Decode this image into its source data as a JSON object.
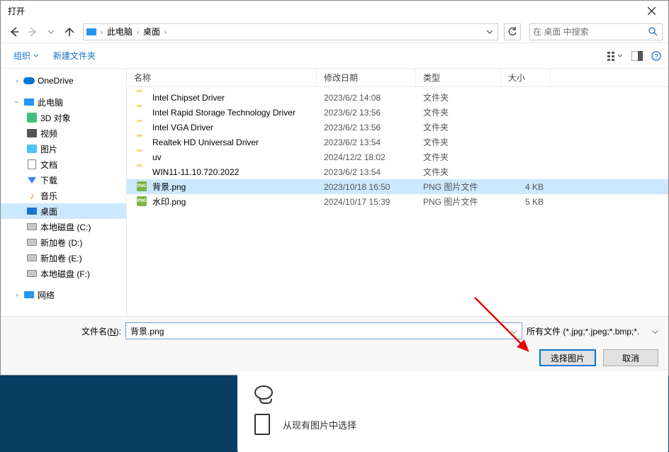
{
  "dialog": {
    "title": "打开",
    "breadcrumb": [
      "此电脑",
      "桌面"
    ],
    "search_placeholder": "在 桌面 中搜索"
  },
  "toolbar": {
    "organize": "组织",
    "new_folder": "新建文件夹"
  },
  "columns": {
    "name": "名称",
    "date": "修改日期",
    "type": "类型",
    "size": "大小"
  },
  "sidebar": {
    "onedrive": "OneDrive",
    "this_pc": "此电脑",
    "items_pc": [
      {
        "label": "3D 对象",
        "icon": "green3d"
      },
      {
        "label": "视频",
        "icon": "video"
      },
      {
        "label": "图片",
        "icon": "pic"
      },
      {
        "label": "文档",
        "icon": "doc"
      },
      {
        "label": "下载",
        "icon": "down"
      },
      {
        "label": "音乐",
        "icon": "music"
      },
      {
        "label": "桌面",
        "icon": "desktop",
        "selected": true
      },
      {
        "label": "本地磁盘 (C:)",
        "icon": "disk"
      },
      {
        "label": "新加卷 (D:)",
        "icon": "disk"
      },
      {
        "label": "新加卷 (E:)",
        "icon": "disk"
      },
      {
        "label": "本地磁盘 (F:)",
        "icon": "disk"
      }
    ],
    "network": "网络"
  },
  "files": [
    {
      "name": "Intel Chipset Driver",
      "date": "2023/6/2 14:08",
      "type": "文件夹",
      "size": "",
      "icon": "folder"
    },
    {
      "name": "Intel Rapid Storage Technology Driver",
      "date": "2023/6/2 13:56",
      "type": "文件夹",
      "size": "",
      "icon": "folder"
    },
    {
      "name": "Intel VGA Driver",
      "date": "2023/6/2 13:56",
      "type": "文件夹",
      "size": "",
      "icon": "folder"
    },
    {
      "name": "Realtek HD Universal Driver",
      "date": "2023/6/2 13:54",
      "type": "文件夹",
      "size": "",
      "icon": "folder"
    },
    {
      "name": "uv",
      "date": "2024/12/2 18:02",
      "type": "文件夹",
      "size": "",
      "icon": "folder"
    },
    {
      "name": "WIN11-11.10.720.2022",
      "date": "2023/6/2 13:54",
      "type": "文件夹",
      "size": "",
      "icon": "folder"
    },
    {
      "name": "背景.png",
      "date": "2023/10/18 16:50",
      "type": "PNG 图片文件",
      "size": "4 KB",
      "icon": "png",
      "selected": true
    },
    {
      "name": "水印.png",
      "date": "2024/10/17 15:39",
      "type": "PNG 图片文件",
      "size": "5 KB",
      "icon": "png"
    }
  ],
  "footer": {
    "filename_label_pre": "文件名(",
    "filename_label_u": "N",
    "filename_label_post": "):",
    "filename_value": "背景.png",
    "filetype": "所有文件 (*.jpg;*.jpeg;*.bmp;*.",
    "open_btn": "选择图片",
    "cancel_btn": "取消"
  },
  "bg_panel": {
    "choose_existing": "从现有图片中选择"
  }
}
